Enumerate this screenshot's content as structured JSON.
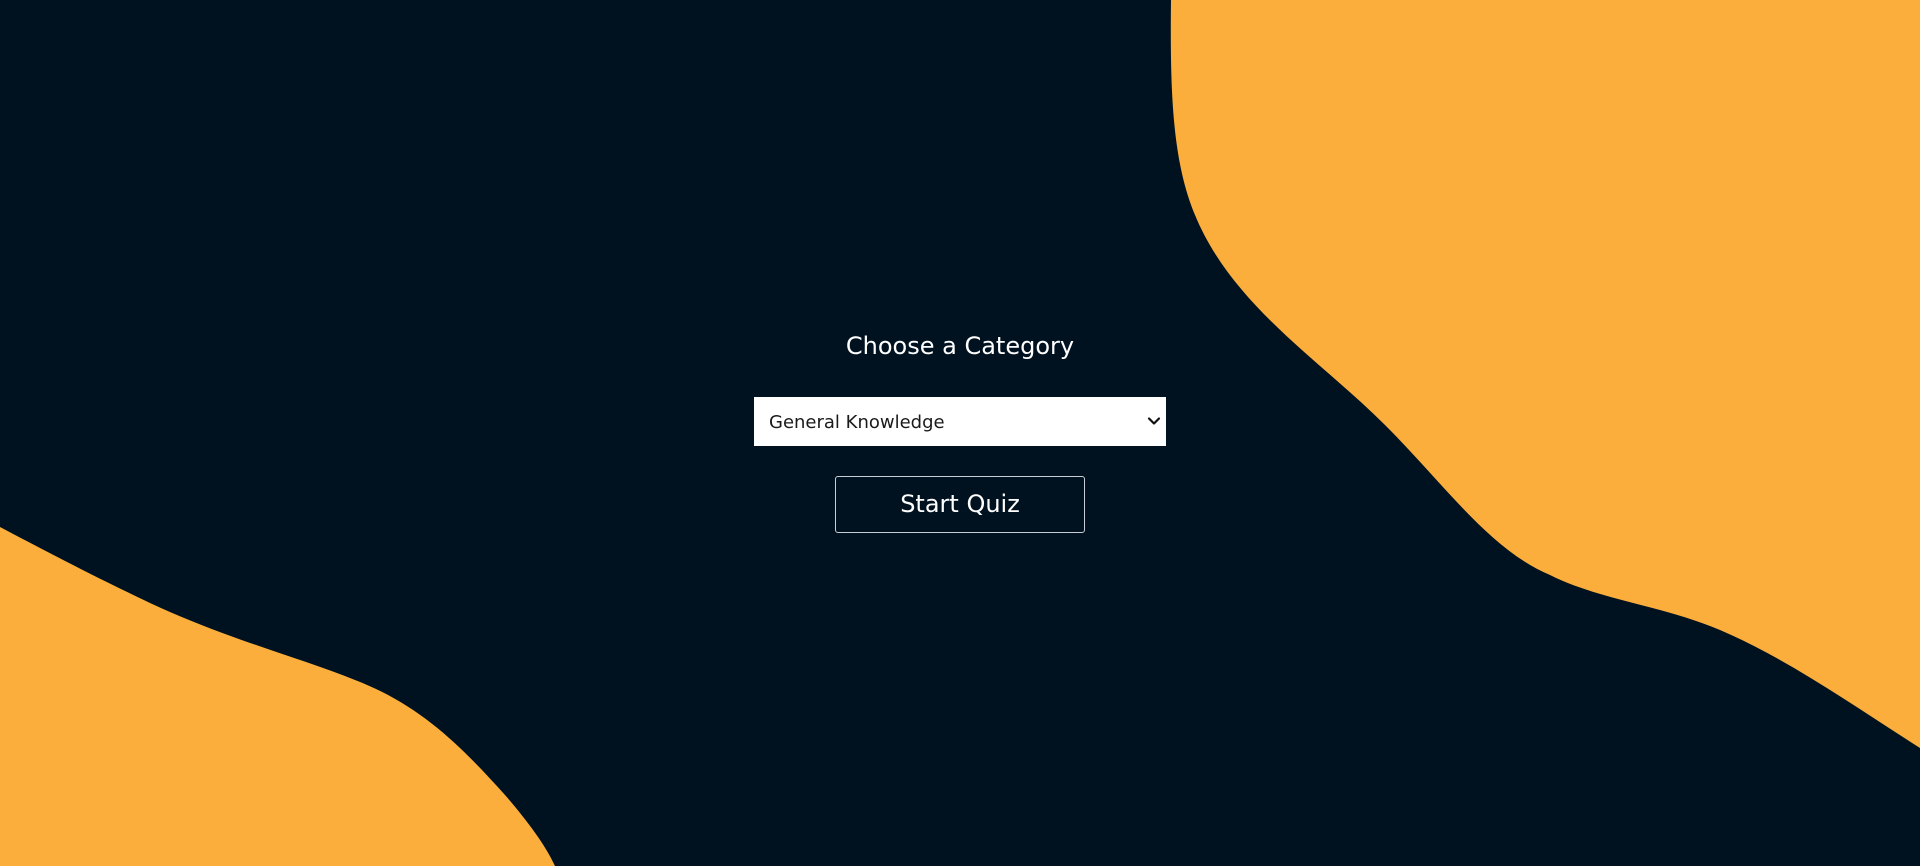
{
  "page": {
    "background_color": "#001220",
    "accent_color": "#FBAE3C"
  },
  "quiz": {
    "heading": "Choose a Category",
    "category_select": {
      "selected": "General Knowledge",
      "icon": "chevron-down-icon"
    },
    "start_button_label": "Start Quiz"
  }
}
